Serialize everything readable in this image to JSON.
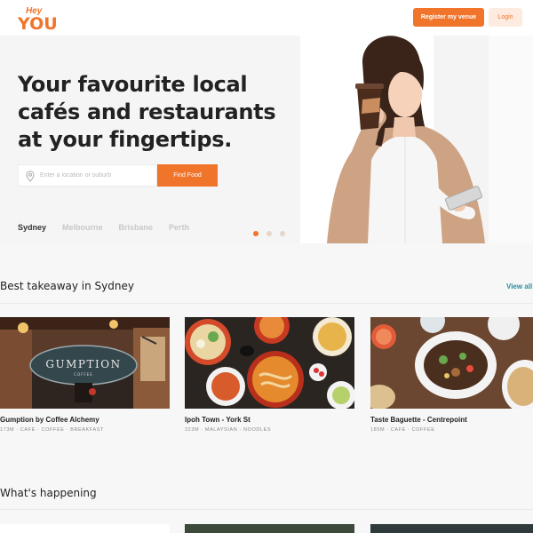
{
  "header": {
    "logo_top": "Hey",
    "logo_bottom": "YOU",
    "register_label": "Register my venue",
    "login_label": "Login"
  },
  "hero": {
    "title_line1": "Your favourite local",
    "title_line2": "cafés and restaurants",
    "title_line3": "at your fingertips.",
    "search_placeholder": "Enter a location or suburb",
    "search_icon": "map-pin-icon",
    "find_label": "Find Food",
    "cities": [
      "Sydney",
      "Melbourne",
      "Brisbane",
      "Perth"
    ],
    "active_city": "Sydney",
    "carousel_dots": 3,
    "active_dot": 0
  },
  "takeaway": {
    "title": "Best takeaway in Sydney",
    "view_all": "View all",
    "cards": [
      {
        "name": "Gumption by Coffee Alchemy",
        "meta": "173M · CAFE · COFFEE · BREAKFAST",
        "sign_text": "GUMPTION",
        "sign_sub": "COFFEE"
      },
      {
        "name": "Ipoh Town - York St",
        "meta": "323M · MALAYSIAN · NOODLES"
      },
      {
        "name": "Taste Baguette - Centrepoint",
        "meta": "185M · CAFE · COFFEE"
      }
    ]
  },
  "happening": {
    "title": "What's happening"
  },
  "colors": {
    "accent": "#f0742a",
    "accent_light": "#fdebe0",
    "link": "#2a8ea0"
  }
}
